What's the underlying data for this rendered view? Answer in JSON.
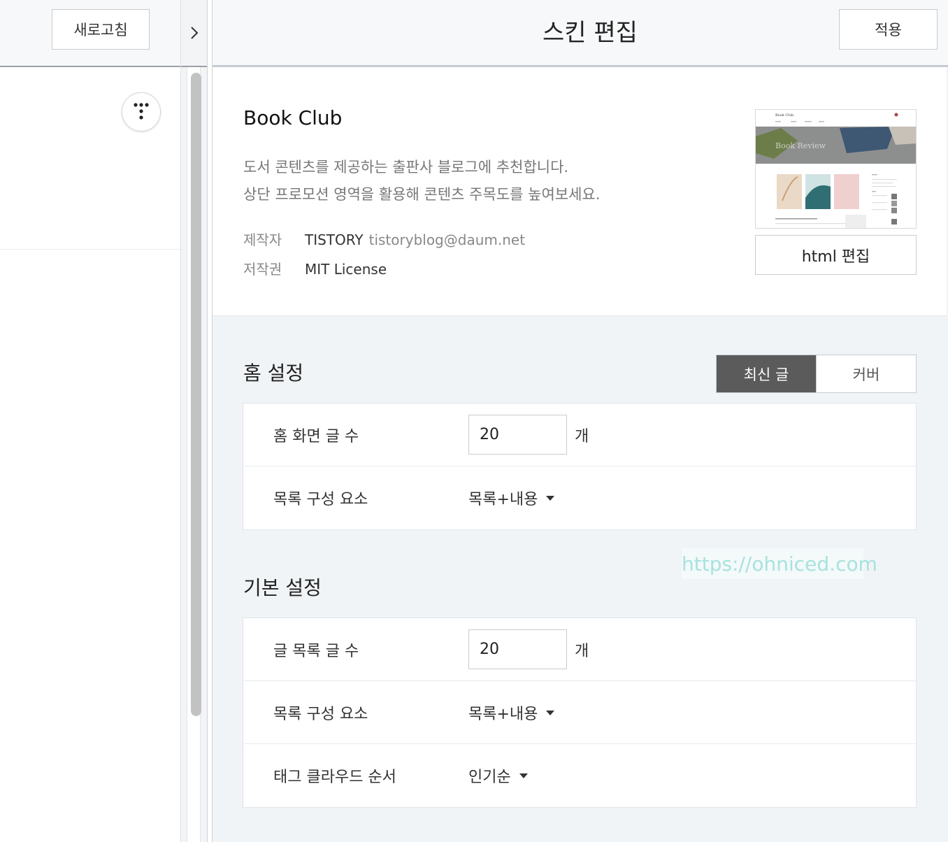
{
  "left_panel": {
    "refresh_label": "새로고침",
    "toggle_icon": "chevron-right-icon",
    "logo_icon": "tistory-logo-icon"
  },
  "header": {
    "title": "스킨 편집",
    "apply_label": "적용"
  },
  "skin": {
    "name": "Book Club",
    "description_line1": "도서 콘텐츠를 제공하는 출판사 블로그에 추천합니다.",
    "description_line2": "상단 프로모션 영역을 활용해 콘텐츠 주목도를 높여보세요.",
    "author_label": "제작자",
    "author_name": "TISTORY",
    "author_email": "tistoryblog@daum.net",
    "license_label": "저작권",
    "license_value": "MIT License",
    "html_edit_label": "html 편집",
    "thumbnail": {
      "site_title": "Book Club",
      "hero_text": "Book Review"
    }
  },
  "home_settings": {
    "title": "홈 설정",
    "tabs": [
      {
        "label": "최신 글",
        "active": true
      },
      {
        "label": "커버",
        "active": false
      }
    ],
    "post_count_label": "홈 화면 글 수",
    "post_count_value": "20",
    "post_count_unit": "개",
    "list_layout_label": "목록 구성 요소",
    "list_layout_value": "목록+내용"
  },
  "basic_settings": {
    "title": "기본 설정",
    "list_count_label": "글 목록 글 수",
    "list_count_value": "20",
    "list_count_unit": "개",
    "list_layout_label": "목록 구성 요소",
    "list_layout_value": "목록+내용",
    "tag_order_label": "태그 클라우드 순서",
    "tag_order_value": "인기순"
  },
  "watermark": "https://ohniced.com",
  "colors": {
    "active_tab": "#5b5b5b",
    "panel_bg": "#f1f4f6",
    "watermark": "#a7e3df"
  }
}
